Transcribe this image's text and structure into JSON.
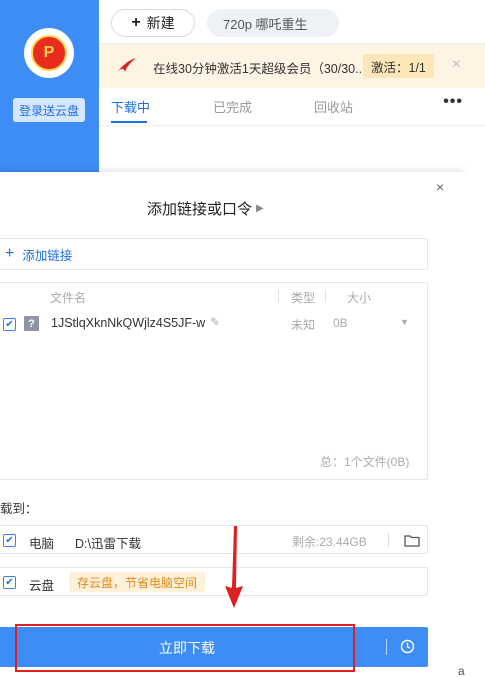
{
  "sidebar": {
    "avatar_badge": "P",
    "login_label": "登录送云盘"
  },
  "topbar": {
    "new_label": "新建",
    "search_text": "720p  哪吒重生"
  },
  "banner": {
    "text": "在线30分钟激活1天超级会员（30/30...",
    "activate": "激活：1/1",
    "close": "×"
  },
  "tabs": {
    "items": [
      "下载中",
      "已完成",
      "回收站"
    ],
    "more": "•••"
  },
  "dialog": {
    "close": "×",
    "title": "添加链接或口令",
    "add_link_label": "添加链接",
    "columns": {
      "name": "文件名",
      "type": "类型",
      "size": "大小"
    },
    "file": {
      "name": "1JStlqXknNkQWjlz4S5JF-w",
      "icon_char": "?",
      "type": "未知",
      "size": "0B"
    },
    "total": "总：1个文件(0B)",
    "save_to": "载到：",
    "pc": {
      "label": "电脑",
      "path": "D:\\迅雷下载",
      "free": "剩余:23.44GB"
    },
    "cloud": {
      "label": "云盘",
      "tip": "存云盘，节省电脑空间"
    },
    "download_label": "立即下载"
  },
  "colors": {
    "accent": "#3e8df5",
    "annotation": "#e02020",
    "banner_bg": "#fdf4e3",
    "tip_text": "#e08a1c"
  },
  "icons": [
    "plus-icon",
    "airline-logo-icon",
    "close-icon",
    "pencil-icon",
    "chevron-down-icon",
    "folder-icon",
    "clock-icon",
    "checkbox-icon",
    "arrow-down-icon"
  ]
}
